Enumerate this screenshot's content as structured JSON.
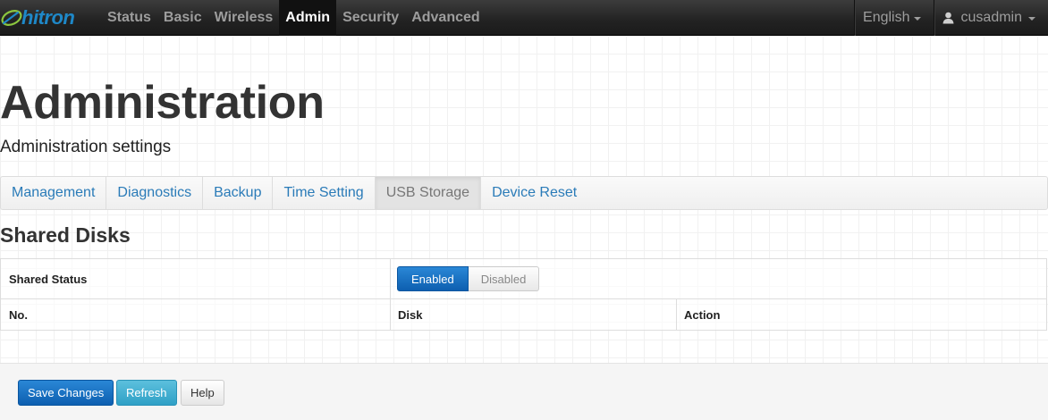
{
  "brand": {
    "name": "hitron",
    "color": "#1e88c8"
  },
  "nav": {
    "items": [
      {
        "label": "Status",
        "active": false
      },
      {
        "label": "Basic",
        "active": false
      },
      {
        "label": "Wireless",
        "active": false
      },
      {
        "label": "Admin",
        "active": true
      },
      {
        "label": "Security",
        "active": false
      },
      {
        "label": "Advanced",
        "active": false
      }
    ],
    "language": "English",
    "user": "cusadmin"
  },
  "page": {
    "title": "Administration",
    "subtitle": "Administration settings"
  },
  "tabs": [
    {
      "label": "Management",
      "active": false
    },
    {
      "label": "Diagnostics",
      "active": false
    },
    {
      "label": "Backup",
      "active": false
    },
    {
      "label": "Time Setting",
      "active": false
    },
    {
      "label": "USB Storage",
      "active": true
    },
    {
      "label": "Device Reset",
      "active": false
    }
  ],
  "section": {
    "title": "Shared Disks",
    "shared_status_label": "Shared Status",
    "toggle": {
      "enabled_label": "Enabled",
      "disabled_label": "Disabled",
      "selected": "Enabled"
    },
    "table_headers": {
      "no": "No.",
      "disk": "Disk",
      "action": "Action"
    }
  },
  "footer": {
    "save_label": "Save Changes",
    "refresh_label": "Refresh",
    "help_label": "Help"
  },
  "colors": {
    "primary": "#0d5fb0",
    "info": "#2fa0c6",
    "link": "#2a7bb8"
  }
}
